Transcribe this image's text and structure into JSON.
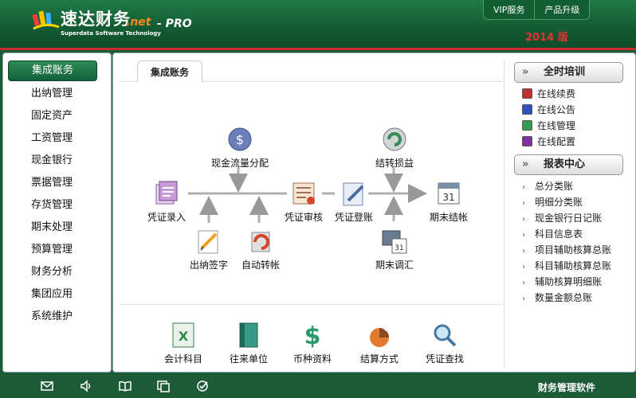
{
  "header": {
    "logo_text": "速达财务",
    "logo_net": ".net",
    "logo_pro": "- PRO",
    "logo_sub": "Superdata Software Technology",
    "top_tabs": [
      "VIP服务",
      "产品升级"
    ],
    "edition": "2014 版"
  },
  "sidebar": {
    "items": [
      {
        "label": "集成账务"
      },
      {
        "label": "出纳管理"
      },
      {
        "label": "固定资产"
      },
      {
        "label": "工资管理"
      },
      {
        "label": "现金银行"
      },
      {
        "label": "票据管理"
      },
      {
        "label": "存货管理"
      },
      {
        "label": "期末处理"
      },
      {
        "label": "预算管理"
      },
      {
        "label": "财务分析"
      },
      {
        "label": "集团应用"
      },
      {
        "label": "系统维护"
      }
    ]
  },
  "main": {
    "tab": "集成账务",
    "flow": {
      "voucher_entry": "凭证录入",
      "cashflow_alloc": "现金流量分配",
      "cashier_sign": "出纳签字",
      "auto_transfer": "自动转帐",
      "voucher_audit": "凭证审核",
      "voucher_post": "凭证登账",
      "carry_profit": "结转损益",
      "period_adjust": "期末调汇",
      "period_close": "期末结帐"
    },
    "bottom_shortcuts": [
      "会计科目",
      "往来单位",
      "币种资料",
      "结算方式",
      "凭证查找"
    ]
  },
  "right_panel": {
    "training": {
      "title": "全时培训",
      "items": [
        "在线续费",
        "在线公告",
        "在线管理",
        "在线配置"
      ]
    },
    "reports": {
      "title": "报表中心",
      "items": [
        "总分类账",
        "明细分类账",
        "现金银行日记账",
        "科目信息表",
        "项目辅助核算总账",
        "科目辅助核算总账",
        "辅助核算明细账",
        "数量金额总账"
      ]
    }
  },
  "footer": {
    "icons": [
      "mail-icon",
      "speaker-icon",
      "book-icon",
      "window-icon",
      "check-icon"
    ],
    "text": "财务管理软件"
  },
  "colors": {
    "header_green": "#145c33",
    "accent_red": "#c92a2a",
    "active_green": "#2e8c55",
    "net_orange": "#ff8a1a"
  }
}
